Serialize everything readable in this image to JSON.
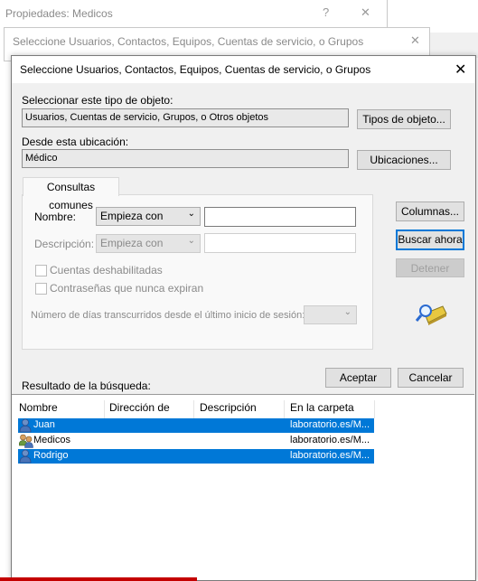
{
  "background_windows": {
    "properties_title": "Propiedades: Medicos",
    "help_glyph": "?",
    "close_glyph": "✕",
    "select_title": "Seleccione Usuarios, Contactos, Equipos, Cuentas de servicio, o Grupos"
  },
  "dialog": {
    "title": "Seleccione Usuarios, Contactos, Equipos, Cuentas de servicio, o Grupos",
    "close_glyph": "✕",
    "object_type_label": "Seleccionar este tipo de objeto:",
    "object_type_value": "Usuarios, Cuentas de servicio, Grupos, o Otros objetos",
    "object_types_button": "Tipos de objeto...",
    "location_label": "Desde esta ubicación:",
    "location_value": "Médico",
    "locations_button": "Ubicaciones...",
    "tab_label": "Consultas comunes",
    "name_label": "Nombre:",
    "name_mode": "Empieza con",
    "name_value": "",
    "description_label": "Descripción:",
    "description_mode": "Empieza con",
    "description_value": "",
    "disabled_accounts_label": "Cuentas deshabilitadas",
    "non_expiring_label": "Contraseñas que nunca expiran",
    "days_label": "Número de días transcurridos desde el último inicio de sesión:",
    "days_value": "",
    "columns_button": "Columnas...",
    "search_button": "Buscar ahora",
    "stop_button": "Detener",
    "search_icon": "binoculars-search-icon",
    "results_label": "Resultado de la búsqueda:",
    "ok_button": "Aceptar",
    "cancel_button": "Cancelar"
  },
  "results": {
    "columns": [
      "Nombre",
      "Dirección de cor...",
      "Descripción",
      "En la carpeta"
    ],
    "rows": [
      {
        "icon": "user-icon",
        "name": "Juan",
        "email": "",
        "description": "",
        "folder": "laboratorio.es/M...",
        "selected": true
      },
      {
        "icon": "group-icon",
        "name": "Medicos",
        "email": "",
        "description": "",
        "folder": "laboratorio.es/M...",
        "selected": false
      },
      {
        "icon": "user-icon",
        "name": "Rodrigo",
        "email": "",
        "description": "",
        "folder": "laboratorio.es/M...",
        "selected": true
      }
    ]
  },
  "colors": {
    "selection": "#0078d7",
    "dialog_bg": "#f0f0f0",
    "accent_red": "#c40000"
  }
}
